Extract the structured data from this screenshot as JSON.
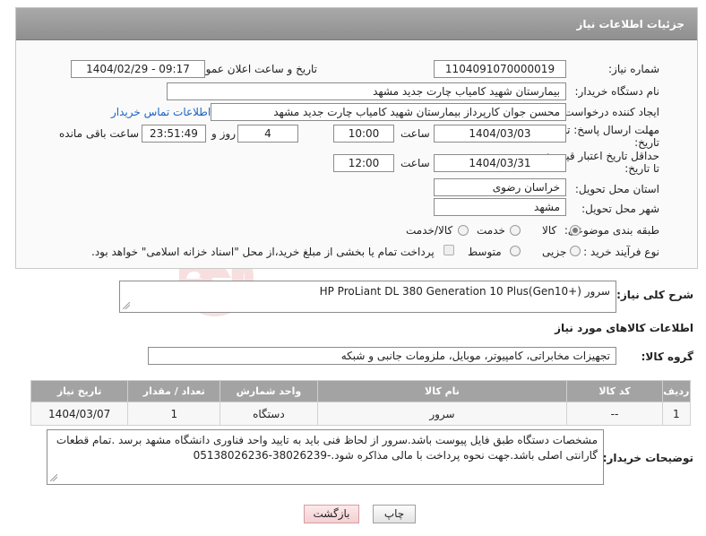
{
  "header": {
    "title": "جزئیات اطلاعات نیاز"
  },
  "fields": {
    "need_number_label": "شماره نیاز:",
    "need_number": "1104091070000019",
    "announce_label": "تاریخ و ساعت اعلان عمومی:",
    "announce_value": "1404/02/29 - 09:17",
    "buyer_org_label": "نام دستگاه خریدار:",
    "buyer_org": "بیمارستان شهید کامیاب چارت جدید مشهد",
    "requester_label": "ایجاد کننده درخواست:",
    "requester": "محسن جوان کارپرداز بیمارستان شهید کامیاب چارت جدید مشهد",
    "buyer_contact_link": "اطلاعات تماس خریدار",
    "deadline_label_1": "مهلت ارسال پاسخ: تا",
    "deadline_label_2": "تاریخ:",
    "deadline_date": "1404/03/03",
    "time_label": "ساعت",
    "deadline_time": "10:00",
    "days_value": "4",
    "days_label": "روز و",
    "remaining_time": "23:51:49",
    "remaining_label": "ساعت باقی مانده",
    "min_validity_label_1": "حداقل تاریخ اعتبار قیمت:",
    "min_validity_label_2": "تا تاریخ:",
    "validity_date": "1404/03/31",
    "validity_time": "12:00",
    "province_label": "استان محل تحویل:",
    "province": "خراسان رضوی",
    "city_label": "شهر محل تحویل:",
    "city": "مشهد",
    "category_label": "طبقه بندی موضوعی:",
    "category_options": [
      "کالا",
      "خدمت",
      "کالا/خدمت"
    ],
    "category_selected": "کالا",
    "process_label": "نوع فرآیند خرید :",
    "process_options": [
      "جزیی",
      "متوسط"
    ],
    "process_selected": "جزیی",
    "payment_note": "پرداخت تمام یا بخشی از مبلغ خرید،از محل \"اسناد خزانه اسلامی\" خواهد بود."
  },
  "description": {
    "label": "شرح کلی نیاز:",
    "value": "سرور (+HP ProLiant DL 380 Generation 10 Plus(Gen10"
  },
  "goods": {
    "section_title": "اطلاعات کالاهای مورد نیاز",
    "group_label": "گروه کالا:",
    "group_value": "تجهیزات مخابراتی، کامپیوتر، موبایل، ملزومات جانبی و شبکه",
    "columns": [
      "ردیف",
      "کد کالا",
      "نام کالا",
      "واحد شمارش",
      "تعداد / مقدار",
      "تاریخ نیاز"
    ],
    "rows": [
      {
        "index": "1",
        "code": "--",
        "name": "سرور",
        "unit": "دستگاه",
        "qty": "1",
        "date": "1404/03/07"
      }
    ]
  },
  "buyer_notes": {
    "label": "توضیحات خریدار:",
    "line1": "مشخصات دستگاه طبق فایل پیوست باشد.سرور از لحاظ فنی باید به تایید واحد فناوری دانشگاه مشهد برسد .تمام قطعات",
    "line2": "گارانتی اصلی باشد.جهت نحوه پرداخت با مالی مذاکره شود.-38026239-05138026236"
  },
  "buttons": {
    "print": "چاپ",
    "back": "بازگشت"
  },
  "watermark": {
    "text": "AriaTender.neT"
  }
}
